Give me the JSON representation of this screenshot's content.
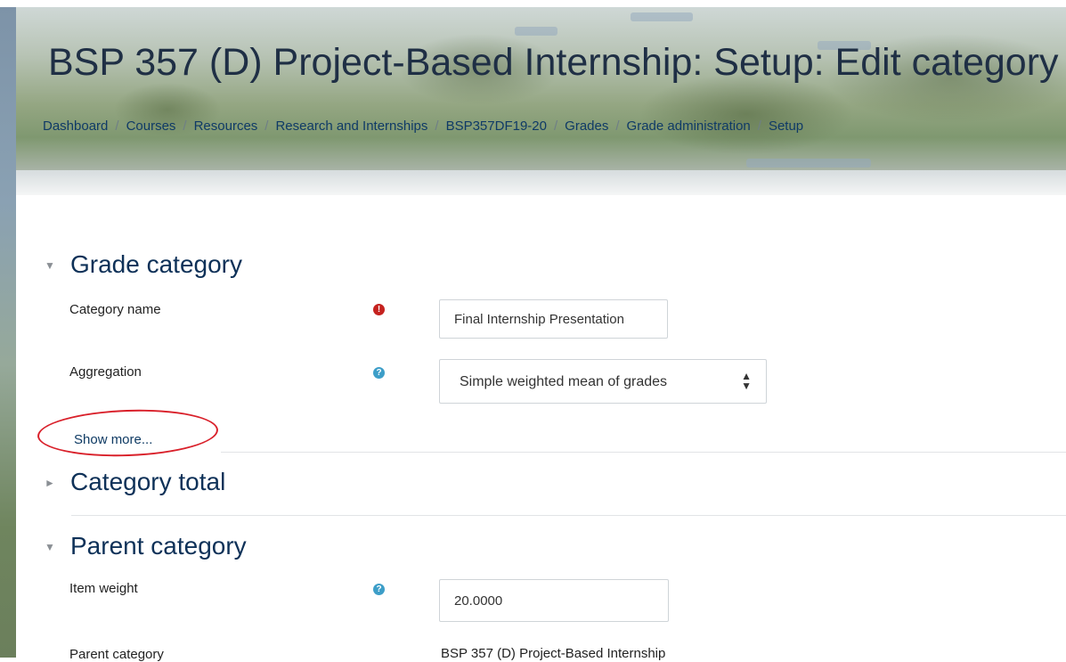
{
  "header": {
    "title": "BSP 357 (D) Project-Based Internship: Setup: Edit category",
    "breadcrumb": [
      {
        "label": "Dashboard"
      },
      {
        "label": "Courses"
      },
      {
        "label": "Resources"
      },
      {
        "label": "Research and Internships"
      },
      {
        "label": "BSP357DF19-20"
      },
      {
        "label": "Grades"
      },
      {
        "label": "Grade administration"
      },
      {
        "label": "Setup"
      }
    ]
  },
  "grade_category": {
    "title": "Grade category",
    "expanded": true,
    "category_name": {
      "label": "Category name",
      "icon": "required-icon",
      "value": "Final Internship Presentation"
    },
    "aggregation": {
      "label": "Aggregation",
      "icon": "help-icon",
      "value": "Simple weighted mean of grades"
    },
    "show_more": "Show more..."
  },
  "category_total": {
    "title": "Category total",
    "expanded": false
  },
  "parent_category": {
    "title": "Parent category",
    "expanded": true,
    "item_weight": {
      "label": "Item weight",
      "icon": "help-icon",
      "value": "20.0000"
    },
    "parent": {
      "label": "Parent category",
      "value": "BSP 357 (D) Project-Based Internship"
    }
  },
  "annotation": {
    "color": "#d9202a",
    "target": "show-more-link"
  },
  "colors": {
    "heading": "#0e3158",
    "link": "#0e3a63",
    "required": "#c5221f",
    "help": "#3d9ec8"
  }
}
